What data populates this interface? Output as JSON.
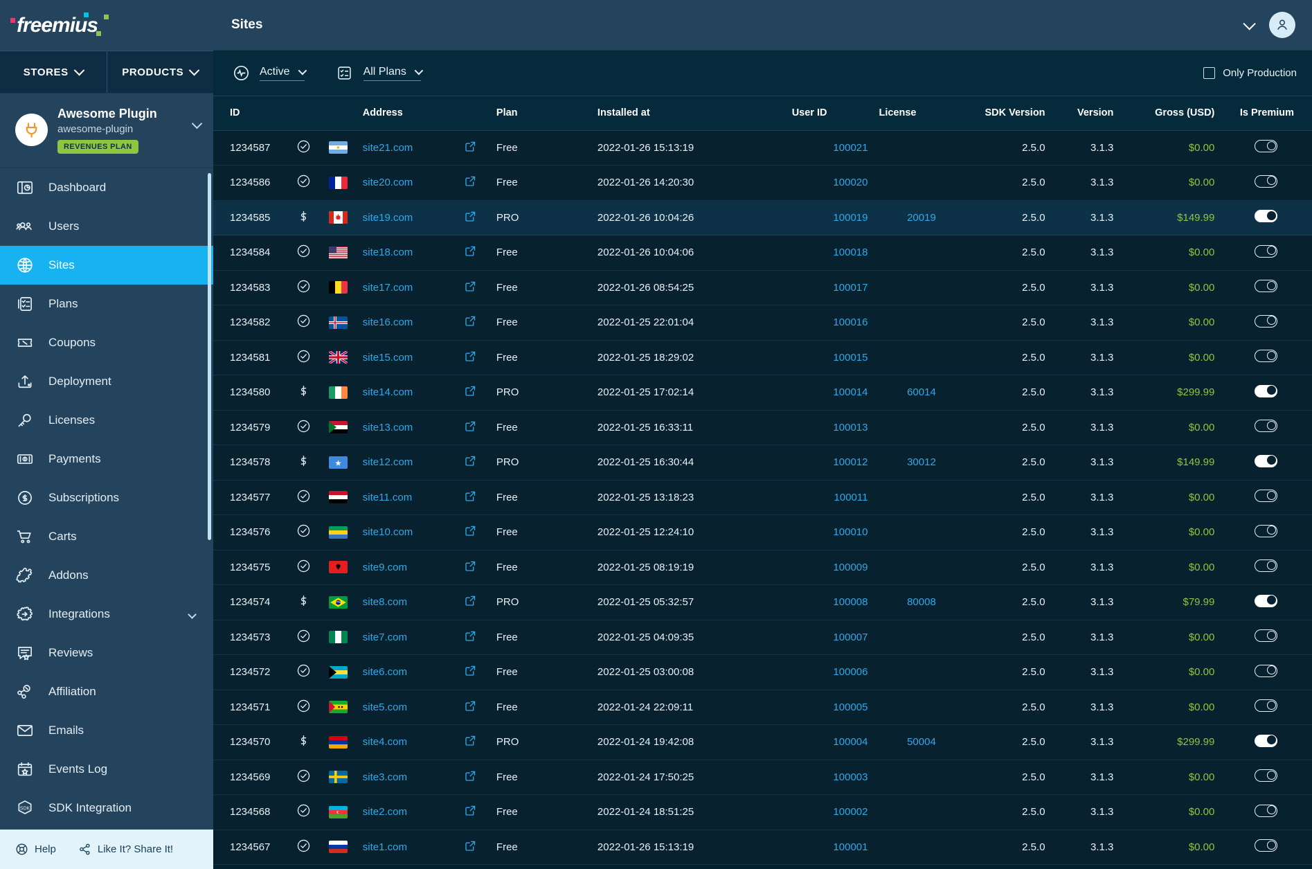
{
  "brand": {
    "logo_text": "freemius"
  },
  "sidebar": {
    "stores_label": "STORES",
    "products_label": "PRODUCTS",
    "product": {
      "title": "Awesome Plugin",
      "slug": "awesome-plugin",
      "badge": "REVENUES PLAN"
    },
    "items": [
      {
        "label": "Dashboard",
        "icon": "dashboard-icon",
        "active": false,
        "chevron": false
      },
      {
        "label": "Users",
        "icon": "users-icon",
        "active": false,
        "chevron": false
      },
      {
        "label": "Sites",
        "icon": "globe-icon",
        "active": true,
        "chevron": false
      },
      {
        "label": "Plans",
        "icon": "plans-icon",
        "active": false,
        "chevron": false
      },
      {
        "label": "Coupons",
        "icon": "coupon-icon",
        "active": false,
        "chevron": false
      },
      {
        "label": "Deployment",
        "icon": "upload-icon",
        "active": false,
        "chevron": false
      },
      {
        "label": "Licenses",
        "icon": "key-icon",
        "active": false,
        "chevron": false
      },
      {
        "label": "Payments",
        "icon": "banknote-icon",
        "active": false,
        "chevron": false
      },
      {
        "label": "Subscriptions",
        "icon": "refresh-dollar-icon",
        "active": false,
        "chevron": false
      },
      {
        "label": "Carts",
        "icon": "cart-icon",
        "active": false,
        "chevron": false
      },
      {
        "label": "Addons",
        "icon": "puzzle-icon",
        "active": false,
        "chevron": false
      },
      {
        "label": "Integrations",
        "icon": "gear-arrow-icon",
        "active": false,
        "chevron": true
      },
      {
        "label": "Reviews",
        "icon": "review-icon",
        "active": false,
        "chevron": false
      },
      {
        "label": "Affiliation",
        "icon": "affiliation-icon",
        "active": false,
        "chevron": false
      },
      {
        "label": "Emails",
        "icon": "envelope-icon",
        "active": false,
        "chevron": false
      },
      {
        "label": "Events Log",
        "icon": "calendar-star-icon",
        "active": false,
        "chevron": false
      },
      {
        "label": "SDK Integration",
        "icon": "sdk-icon",
        "active": false,
        "chevron": false
      }
    ],
    "footer": {
      "help_label": "Help",
      "share_label": "Like It? Share It!"
    }
  },
  "header": {
    "title": "Sites"
  },
  "filters": {
    "status": "Active",
    "plans": "All Plans",
    "only_production_label": "Only Production",
    "only_production_checked": false
  },
  "table": {
    "columns": [
      "ID",
      "Address",
      "Plan",
      "Installed at",
      "User ID",
      "License",
      "SDK Version",
      "Version",
      "Gross (USD)",
      "Is Premium"
    ],
    "rows": [
      {
        "id": "1234587",
        "status": "check",
        "flag": "ar",
        "address": "site21.com",
        "plan": "Free",
        "installed": "2022-01-26 15:13:19",
        "user_id": "100021",
        "license": "",
        "sdk": "2.5.0",
        "version": "3.1.3",
        "gross": "$0.00",
        "premium": false,
        "highlight": false
      },
      {
        "id": "1234586",
        "status": "check",
        "flag": "fr",
        "address": "site20.com",
        "plan": "Free",
        "installed": "2022-01-26 14:20:30",
        "user_id": "100020",
        "license": "",
        "sdk": "2.5.0",
        "version": "3.1.3",
        "gross": "$0.00",
        "premium": false,
        "highlight": false
      },
      {
        "id": "1234585",
        "status": "dollar",
        "flag": "ca",
        "address": "site19.com",
        "plan": "PRO",
        "installed": "2022-01-26 10:04:26",
        "user_id": "100019",
        "license": "20019",
        "sdk": "2.5.0",
        "version": "3.1.3",
        "gross": "$149.99",
        "premium": true,
        "highlight": true
      },
      {
        "id": "1234584",
        "status": "check",
        "flag": "us",
        "address": "site18.com",
        "plan": "Free",
        "installed": "2022-01-26 10:04:06",
        "user_id": "100018",
        "license": "",
        "sdk": "2.5.0",
        "version": "3.1.3",
        "gross": "$0.00",
        "premium": false,
        "highlight": false
      },
      {
        "id": "1234583",
        "status": "check",
        "flag": "be",
        "address": "site17.com",
        "plan": "Free",
        "installed": "2022-01-26 08:54:25",
        "user_id": "100017",
        "license": "",
        "sdk": "2.5.0",
        "version": "3.1.3",
        "gross": "$0.00",
        "premium": false,
        "highlight": false
      },
      {
        "id": "1234582",
        "status": "check",
        "flag": "is",
        "address": "site16.com",
        "plan": "Free",
        "installed": "2022-01-25 22:01:04",
        "user_id": "100016",
        "license": "",
        "sdk": "2.5.0",
        "version": "3.1.3",
        "gross": "$0.00",
        "premium": false,
        "highlight": false
      },
      {
        "id": "1234581",
        "status": "check",
        "flag": "gb",
        "address": "site15.com",
        "plan": "Free",
        "installed": "2022-01-25 18:29:02",
        "user_id": "100015",
        "license": "",
        "sdk": "2.5.0",
        "version": "3.1.3",
        "gross": "$0.00",
        "premium": false,
        "highlight": false
      },
      {
        "id": "1234580",
        "status": "dollar",
        "flag": "ie",
        "address": "site14.com",
        "plan": "PRO",
        "installed": "2022-01-25 17:02:14",
        "user_id": "100014",
        "license": "60014",
        "sdk": "2.5.0",
        "version": "3.1.3",
        "gross": "$299.99",
        "premium": true,
        "highlight": false
      },
      {
        "id": "1234579",
        "status": "check",
        "flag": "sd",
        "address": "site13.com",
        "plan": "Free",
        "installed": "2022-01-25 16:33:11",
        "user_id": "100013",
        "license": "",
        "sdk": "2.5.0",
        "version": "3.1.3",
        "gross": "$0.00",
        "premium": false,
        "highlight": false
      },
      {
        "id": "1234578",
        "status": "dollar",
        "flag": "so",
        "address": "site12.com",
        "plan": "PRO",
        "installed": "2022-01-25 16:30:44",
        "user_id": "100012",
        "license": "30012",
        "sdk": "2.5.0",
        "version": "3.1.3",
        "gross": "$149.99",
        "premium": true,
        "highlight": false
      },
      {
        "id": "1234577",
        "status": "check",
        "flag": "ye",
        "address": "site11.com",
        "plan": "Free",
        "installed": "2022-01-25 13:18:23",
        "user_id": "100011",
        "license": "",
        "sdk": "2.5.0",
        "version": "3.1.3",
        "gross": "$0.00",
        "premium": false,
        "highlight": false
      },
      {
        "id": "1234576",
        "status": "check",
        "flag": "ga",
        "address": "site10.com",
        "plan": "Free",
        "installed": "2022-01-25 12:24:10",
        "user_id": "100010",
        "license": "",
        "sdk": "2.5.0",
        "version": "3.1.3",
        "gross": "$0.00",
        "premium": false,
        "highlight": false
      },
      {
        "id": "1234575",
        "status": "check",
        "flag": "al",
        "address": "site9.com",
        "plan": "Free",
        "installed": "2022-01-25 08:19:19",
        "user_id": "100009",
        "license": "",
        "sdk": "2.5.0",
        "version": "3.1.3",
        "gross": "$0.00",
        "premium": false,
        "highlight": false
      },
      {
        "id": "1234574",
        "status": "dollar",
        "flag": "br",
        "address": "site8.com",
        "plan": "PRO",
        "installed": "2022-01-25 05:32:57",
        "user_id": "100008",
        "license": "80008",
        "sdk": "2.5.0",
        "version": "3.1.3",
        "gross": "$79.99",
        "premium": true,
        "highlight": false
      },
      {
        "id": "1234573",
        "status": "check",
        "flag": "ng",
        "address": "site7.com",
        "plan": "Free",
        "installed": "2022-01-25 04:09:35",
        "user_id": "100007",
        "license": "",
        "sdk": "2.5.0",
        "version": "3.1.3",
        "gross": "$0.00",
        "premium": false,
        "highlight": false
      },
      {
        "id": "1234572",
        "status": "check",
        "flag": "bs",
        "address": "site6.com",
        "plan": "Free",
        "installed": "2022-01-25 03:00:08",
        "user_id": "100006",
        "license": "",
        "sdk": "2.5.0",
        "version": "3.1.3",
        "gross": "$0.00",
        "premium": false,
        "highlight": false
      },
      {
        "id": "1234571",
        "status": "check",
        "flag": "st",
        "address": "site5.com",
        "plan": "Free",
        "installed": "2022-01-24 22:09:11",
        "user_id": "100005",
        "license": "",
        "sdk": "2.5.0",
        "version": "3.1.3",
        "gross": "$0.00",
        "premium": false,
        "highlight": false
      },
      {
        "id": "1234570",
        "status": "dollar",
        "flag": "am",
        "address": "site4.com",
        "plan": "PRO",
        "installed": "2022-01-24 19:42:08",
        "user_id": "100004",
        "license": "50004",
        "sdk": "2.5.0",
        "version": "3.1.3",
        "gross": "$299.99",
        "premium": true,
        "highlight": false
      },
      {
        "id": "1234569",
        "status": "check",
        "flag": "se",
        "address": "site3.com",
        "plan": "Free",
        "installed": "2022-01-24 17:50:25",
        "user_id": "100003",
        "license": "",
        "sdk": "2.5.0",
        "version": "3.1.3",
        "gross": "$0.00",
        "premium": false,
        "highlight": false
      },
      {
        "id": "1234568",
        "status": "check",
        "flag": "az",
        "address": "site2.com",
        "plan": "Free",
        "installed": "2022-01-24 18:51:25",
        "user_id": "100002",
        "license": "",
        "sdk": "2.5.0",
        "version": "3.1.3",
        "gross": "$0.00",
        "premium": false,
        "highlight": false
      },
      {
        "id": "1234567",
        "status": "check",
        "flag": "ru",
        "address": "site1.com",
        "plan": "Free",
        "installed": "2022-01-26 15:13:19",
        "user_id": "100001",
        "license": "",
        "sdk": "2.5.0",
        "version": "3.1.3",
        "gross": "$0.00",
        "premium": false,
        "highlight": false
      }
    ]
  },
  "colors": {
    "accent": "#16b3f0",
    "link": "#2fa8e8",
    "money": "#8dc63f",
    "badge": "#8dc63f",
    "sidebar": "#24445e",
    "table_bg": "#08212e"
  }
}
